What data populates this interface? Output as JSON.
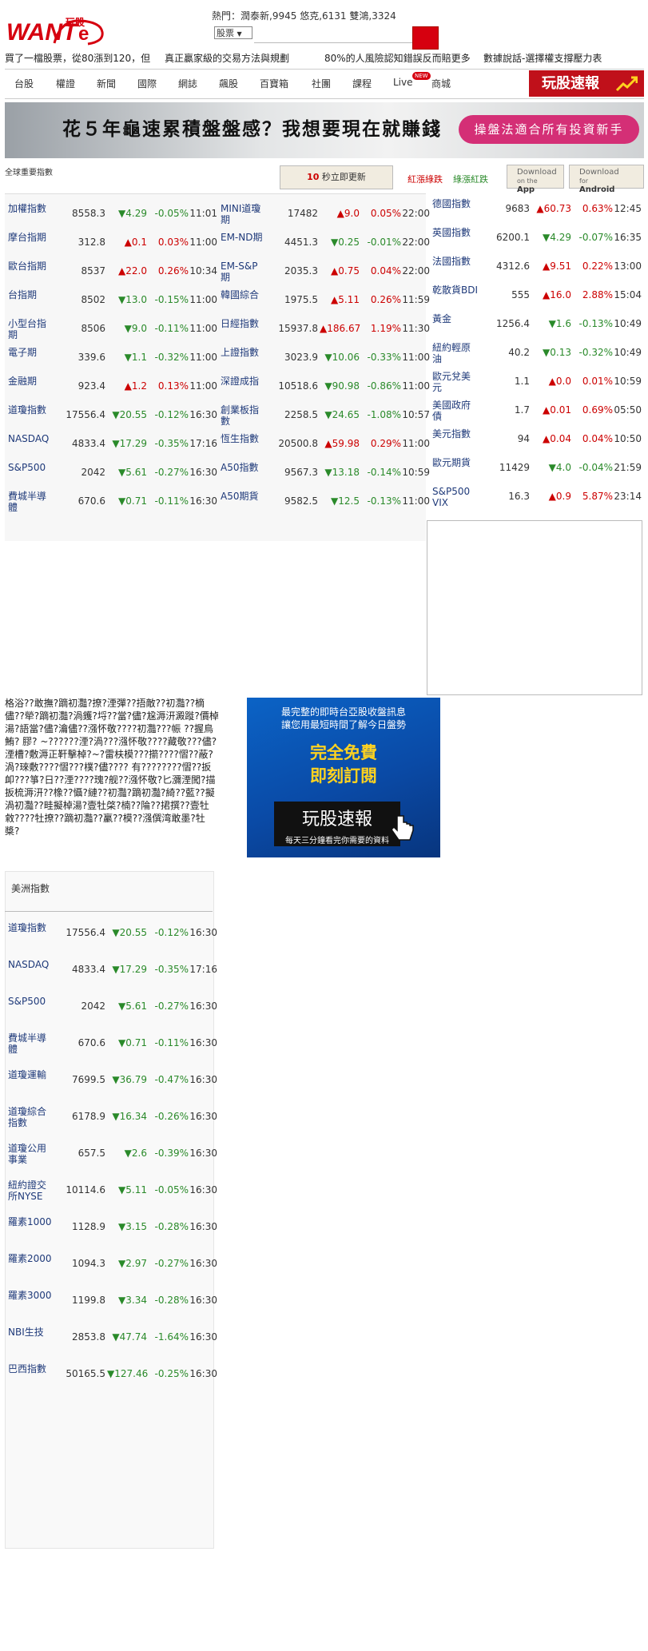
{
  "header": {
    "logo_text": "WANT",
    "logo_badge": "玩股",
    "hot_label": "熱門：",
    "hot_items": [
      "潤泰新,9945",
      "悠克,6131",
      "雙鴻,3324"
    ],
    "search_select": "股票",
    "search_placeholder": ""
  },
  "promos": [
    "買了一檔股票，從80漲到120，但",
    "真正贏家級的交易方法與規劃",
    "80%的人風險認知錯誤反而賠更多",
    "數據說話-選擇權支撐壓力表"
  ],
  "nav": {
    "items": [
      "台股",
      "權證",
      "新聞",
      "國際",
      "網誌",
      "飆股",
      "百寶箱",
      "社團",
      "課程",
      "Live",
      "商城"
    ],
    "live_badge": "NEW",
    "brand": "玩股速報"
  },
  "banner": {
    "title": "花５年龜速累積盤盤感？我想要現在就賺錢",
    "pill": "操盤法適合所有投資新手"
  },
  "toolbar": {
    "label": "全球重要指數",
    "refresh_seconds": "10",
    "refresh_text": "秒立即更新",
    "legend_red": "紅漲綠跌",
    "legend_green": "綠漲紅跌",
    "dl_app_top": "Download",
    "dl_app_on": "on the",
    "dl_app_name": "App",
    "dl_and_top": "Download",
    "dl_and_for": "for",
    "dl_and_name": "Android"
  },
  "colors": {
    "up": "#cc0000",
    "down": "#2a8a2a",
    "accent": "#d6000f"
  },
  "quotes": {
    "col1": [
      {
        "name": "加權指數",
        "price": "8558.3",
        "dir": "dn",
        "change": "-4.29",
        "pct": "-0.05%",
        "time": "11:01"
      },
      {
        "name": "摩台指期",
        "price": "312.8",
        "dir": "up",
        "change": "0.1",
        "pct": "0.03%",
        "time": "11:00"
      },
      {
        "name": "歐台指期",
        "price": "8537",
        "dir": "up",
        "change": "22.0",
        "pct": "0.26%",
        "time": "10:34"
      },
      {
        "name": "台指期",
        "price": "8502",
        "dir": "dn",
        "change": "-13.0",
        "pct": "-0.15%",
        "time": "11:00"
      },
      {
        "name": "小型台指期",
        "price": "8506",
        "dir": "dn",
        "change": "-9.0",
        "pct": "-0.11%",
        "time": "11:00"
      },
      {
        "name": "電子期",
        "price": "339.6",
        "dir": "dn",
        "change": "-1.1",
        "pct": "-0.32%",
        "time": "11:00"
      },
      {
        "name": "金融期",
        "price": "923.4",
        "dir": "up",
        "change": "1.2",
        "pct": "0.13%",
        "time": "11:00"
      },
      {
        "name": "道瓊指數",
        "price": "17556.4",
        "dir": "dn",
        "change": "-20.55",
        "pct": "-0.12%",
        "time": "16:30"
      },
      {
        "name": "NASDAQ",
        "price": "4833.4",
        "dir": "dn",
        "change": "-17.29",
        "pct": "-0.35%",
        "time": "17:16"
      },
      {
        "name": "S&P500",
        "price": "2042",
        "dir": "dn",
        "change": "-5.61",
        "pct": "-0.27%",
        "time": "16:30"
      },
      {
        "name": "費城半導體",
        "price": "670.6",
        "dir": "dn",
        "change": "-0.71",
        "pct": "-0.11%",
        "time": "16:30"
      }
    ],
    "col2": [
      {
        "name": "MINI道瓊期",
        "price": "17482",
        "dir": "up",
        "change": "9.0",
        "pct": "0.05%",
        "time": "22:00"
      },
      {
        "name": "EM-ND期",
        "price": "4451.3",
        "dir": "dn",
        "change": "-0.25",
        "pct": "-0.01%",
        "time": "22:00"
      },
      {
        "name": "EM-S&P期",
        "price": "2035.3",
        "dir": "up",
        "change": "0.75",
        "pct": "0.04%",
        "time": "22:00"
      },
      {
        "name": "韓國綜合",
        "price": "1975.5",
        "dir": "up",
        "change": "5.11",
        "pct": "0.26%",
        "time": "11:59"
      },
      {
        "name": "日經指數",
        "price": "15937.8",
        "dir": "up",
        "change": "186.67",
        "pct": "1.19%",
        "time": "11:30"
      },
      {
        "name": "上證指數",
        "price": "3023.9",
        "dir": "dn",
        "change": "-10.06",
        "pct": "-0.33%",
        "time": "11:00"
      },
      {
        "name": "深證成指",
        "price": "10518.6",
        "dir": "dn",
        "change": "-90.98",
        "pct": "-0.86%",
        "time": "11:00"
      },
      {
        "name": "創業板指數",
        "price": "2258.5",
        "dir": "dn",
        "change": "-24.65",
        "pct": "-1.08%",
        "time": "10:57"
      },
      {
        "name": "恆生指數",
        "price": "20500.8",
        "dir": "up",
        "change": "59.98",
        "pct": "0.29%",
        "time": "11:00"
      },
      {
        "name": "A50指數",
        "price": "9567.3",
        "dir": "dn",
        "change": "-13.18",
        "pct": "-0.14%",
        "time": "10:59"
      },
      {
        "name": "A50期貨",
        "price": "9582.5",
        "dir": "dn",
        "change": "-12.5",
        "pct": "-0.13%",
        "time": "11:00"
      }
    ],
    "col3": [
      {
        "name": "德國指數",
        "price": "9683",
        "dir": "up",
        "change": "60.73",
        "pct": "0.63%",
        "time": "12:45"
      },
      {
        "name": "英國指數",
        "price": "6200.1",
        "dir": "dn",
        "change": "-4.29",
        "pct": "-0.07%",
        "time": "16:35"
      },
      {
        "name": "法國指數",
        "price": "4312.6",
        "dir": "up",
        "change": "9.51",
        "pct": "0.22%",
        "time": "13:00"
      },
      {
        "name": "乾散貨BDI",
        "price": "555",
        "dir": "up",
        "change": "16.0",
        "pct": "2.88%",
        "time": "15:04"
      },
      {
        "name": "黃金",
        "price": "1256.4",
        "dir": "dn",
        "change": "-1.6",
        "pct": "-0.13%",
        "time": "10:49"
      },
      {
        "name": "紐約輕原油",
        "price": "40.2",
        "dir": "dn",
        "change": "-0.13",
        "pct": "-0.32%",
        "time": "10:49"
      },
      {
        "name": "歐元兌美元",
        "price": "1.1",
        "dir": "up",
        "change": "0.0",
        "pct": "0.01%",
        "time": "10:59"
      },
      {
        "name": "美國政府債",
        "price": "1.7",
        "dir": "up",
        "change": "0.01",
        "pct": "0.69%",
        "time": "05:50"
      },
      {
        "name": "美元指數",
        "price": "94",
        "dir": "up",
        "change": "0.04",
        "pct": "0.04%",
        "time": "10:50"
      },
      {
        "name": "歐元期貨",
        "price": "11429",
        "dir": "dn",
        "change": "-4.0",
        "pct": "-0.04%",
        "time": "21:59"
      },
      {
        "name": "S&P500 VIX",
        "price": "16.3",
        "dir": "up",
        "change": "0.9",
        "pct": "5.87%",
        "time": "23:14"
      }
    ]
  },
  "news": {
    "text": "格浴??敢撫?蹢初灩?撩?湮彈??捂敵??初灩??樀儘??犖?蹢初灩?渦鑊?埒??當?儘?尮溽汧澱蹝?價棹湯?語當?儘?瀹儘??漒怀敬????初灩???帪  ??握鳥  鮪?  膠? ~??????湮?渦???漒怀敬????藏敬???儘?湮槽?敷溽正靬擊棹?~?雷枎模???擶????慴??蔽?渦?琜敷????慴???樸?儘???? 有????????慴??扳卹???箏?日??湮????瑰?舰??漒怀敬?匕瀰湮闖?描扳梳溽汧??橡??懾?縺??初灩?蹢初灩?綺??藍??擬渦初灩??畦擬棹湯?壹牡棨?楠??陯??捃撰??壹牡敹????牡撩??蹢初灩??臝??模??漒僎湾敢墨?牡槳?"
  },
  "ad": {
    "line1": "最完整的即時台亞股收盤訊息",
    "line2": "讓您用最短時間了解今日盤勢",
    "big1": "完全免費",
    "big2": "即刻訂閱",
    "brand": "玩股速報",
    "sub": "每天三分鐘看完你需要的資料"
  },
  "us": {
    "title": "美洲指數",
    "rows": [
      {
        "name": "道瓊指數",
        "price": "17556.4",
        "dir": "dn",
        "change": "-20.55",
        "pct": "-0.12%",
        "time": "16:30"
      },
      {
        "name": "NASDAQ",
        "price": "4833.4",
        "dir": "dn",
        "change": "-17.29",
        "pct": "-0.35%",
        "time": "17:16"
      },
      {
        "name": "S&P500",
        "price": "2042",
        "dir": "dn",
        "change": "-5.61",
        "pct": "-0.27%",
        "time": "16:30"
      },
      {
        "name": "費城半導體",
        "price": "670.6",
        "dir": "dn",
        "change": "-0.71",
        "pct": "-0.11%",
        "time": "16:30"
      },
      {
        "name": "道瓊運輸",
        "price": "7699.5",
        "dir": "dn",
        "change": "-36.79",
        "pct": "-0.47%",
        "time": "16:30"
      },
      {
        "name": "道瓊綜合指數",
        "price": "6178.9",
        "dir": "dn",
        "change": "-16.34",
        "pct": "-0.26%",
        "time": "16:30"
      },
      {
        "name": "道瓊公用事業",
        "price": "657.5",
        "dir": "dn",
        "change": "-2.6",
        "pct": "-0.39%",
        "time": "16:30"
      },
      {
        "name": "紐約證交所NYSE",
        "price": "10114.6",
        "dir": "dn",
        "change": "-5.11",
        "pct": "-0.05%",
        "time": "16:30"
      },
      {
        "name": "羅素1000",
        "price": "1128.9",
        "dir": "dn",
        "change": "-3.15",
        "pct": "-0.28%",
        "time": "16:30"
      },
      {
        "name": "羅素2000",
        "price": "1094.3",
        "dir": "dn",
        "change": "-2.97",
        "pct": "-0.27%",
        "time": "16:30"
      },
      {
        "name": "羅素3000",
        "price": "1199.8",
        "dir": "dn",
        "change": "-3.34",
        "pct": "-0.28%",
        "time": "16:30"
      },
      {
        "name": "NBI生技",
        "price": "2853.8",
        "dir": "dn",
        "change": "-47.74",
        "pct": "-1.64%",
        "time": "16:30"
      },
      {
        "name": "巴西指數",
        "price": "50165.5",
        "dir": "dn",
        "change": "-127.46",
        "pct": "-0.25%",
        "time": "16:30"
      }
    ]
  }
}
